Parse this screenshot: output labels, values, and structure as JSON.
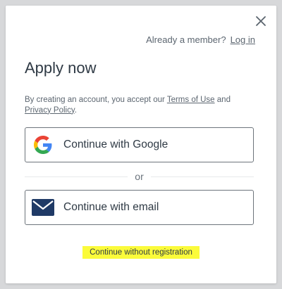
{
  "modal": {
    "member_prompt": "Already a member?",
    "login_link": "Log in",
    "title": "Apply now",
    "terms": {
      "prefix": "By creating an account, you accept our",
      "terms_link": "Terms of Use",
      "and": "and",
      "privacy_link": "Privacy Policy",
      "suffix": "."
    },
    "google_button": "Continue with Google",
    "or": "or",
    "email_button": "Continue with email",
    "skip_link": "Continue without registration"
  },
  "colors": {
    "text": "#2f3a45",
    "muted": "#5c6670",
    "highlight": "#fbfb3a",
    "envelope": "#1f3a66",
    "google_blue": "#4285F4",
    "google_red": "#EA4335",
    "google_yellow": "#FBBC05",
    "google_green": "#34A853"
  },
  "icons": {
    "close": "close-icon",
    "google": "google-icon",
    "email": "envelope-icon"
  }
}
